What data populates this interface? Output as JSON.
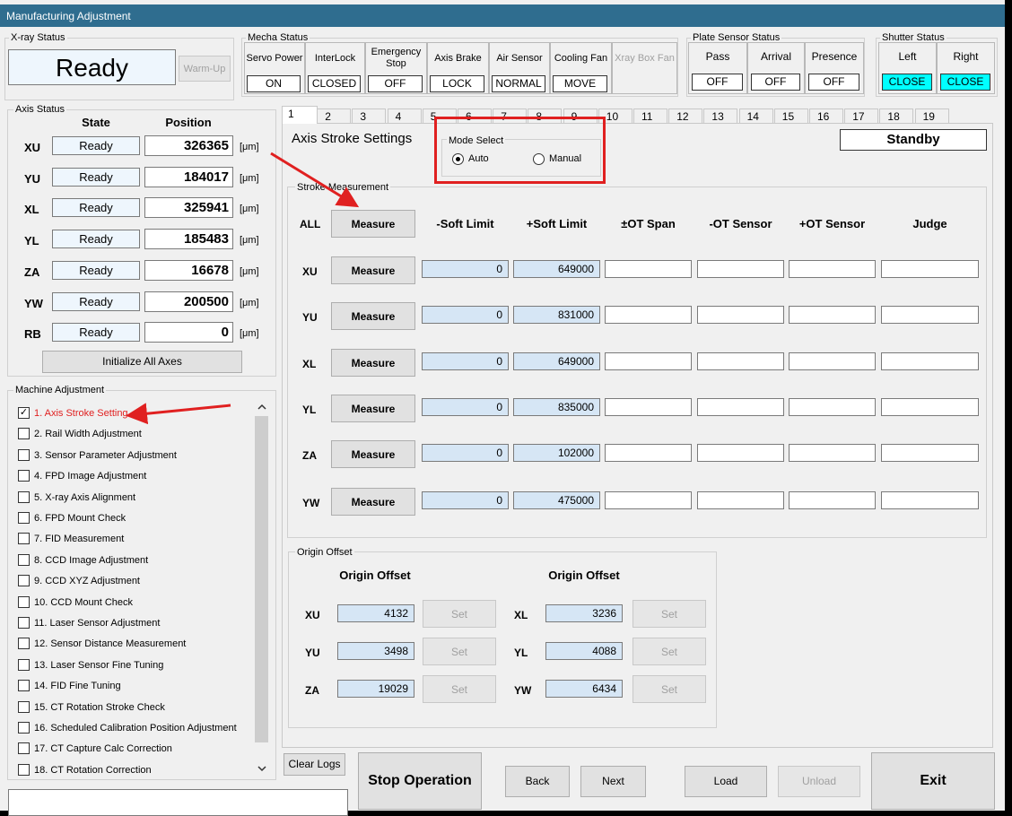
{
  "window": {
    "title": "Manufacturing Adjustment"
  },
  "xray": {
    "group_title": "X-ray Status",
    "status": "Ready",
    "warmup_label": "Warm-Up"
  },
  "mecha": {
    "group_title": "Mecha Status",
    "items": [
      {
        "label": "Servo Power",
        "value": "ON"
      },
      {
        "label": "InterLock",
        "value": "CLOSED"
      },
      {
        "label": "Emergency Stop",
        "value": "OFF"
      },
      {
        "label": "Axis Brake",
        "value": "LOCK"
      },
      {
        "label": "Air Sensor",
        "value": "NORMAL"
      },
      {
        "label": "Cooling Fan",
        "value": "MOVE"
      },
      {
        "label": "Xray Box Fan",
        "value": ""
      }
    ]
  },
  "plate": {
    "group_title": "Plate Sensor Status",
    "items": [
      {
        "label": "Pass",
        "value": "OFF"
      },
      {
        "label": "Arrival",
        "value": "OFF"
      },
      {
        "label": "Presence",
        "value": "OFF"
      }
    ]
  },
  "shutter": {
    "group_title": "Shutter Status",
    "items": [
      {
        "label": "Left",
        "value": "CLOSE"
      },
      {
        "label": "Right",
        "value": "CLOSE"
      }
    ]
  },
  "axis_status": {
    "group_title": "Axis Status",
    "col_state": "State",
    "col_position": "Position",
    "unit": "[μm]",
    "axes": [
      {
        "name": "XU",
        "state": "Ready",
        "position": "326365"
      },
      {
        "name": "YU",
        "state": "Ready",
        "position": "184017"
      },
      {
        "name": "XL",
        "state": "Ready",
        "position": "325941"
      },
      {
        "name": "YL",
        "state": "Ready",
        "position": "185483"
      },
      {
        "name": "ZA",
        "state": "Ready",
        "position": "16678"
      },
      {
        "name": "YW",
        "state": "Ready",
        "position": "200500"
      },
      {
        "name": "RB",
        "state": "Ready",
        "position": "0"
      }
    ],
    "init_button": "Initialize All Axes"
  },
  "machine_adjustment": {
    "group_title": "Machine Adjustment",
    "items": [
      {
        "label": "1. Axis Stroke Setting",
        "checked": true
      },
      {
        "label": "2. Rail Width Adjustment",
        "checked": false
      },
      {
        "label": "3. Sensor Parameter Adjustment",
        "checked": false
      },
      {
        "label": "4. FPD Image Adjustment",
        "checked": false
      },
      {
        "label": "5. X-ray Axis Alignment",
        "checked": false
      },
      {
        "label": "6. FPD Mount Check",
        "checked": false
      },
      {
        "label": "7. FID Measurement",
        "checked": false
      },
      {
        "label": "8. CCD Image Adjustment",
        "checked": false
      },
      {
        "label": "9. CCD XYZ Adjustment",
        "checked": false
      },
      {
        "label": "10. CCD Mount Check",
        "checked": false
      },
      {
        "label": "11. Laser Sensor Adjustment",
        "checked": false
      },
      {
        "label": "12. Sensor Distance Measurement",
        "checked": false
      },
      {
        "label": "13. Laser Sensor Fine Tuning",
        "checked": false
      },
      {
        "label": "14. FID Fine Tuning",
        "checked": false
      },
      {
        "label": "15. CT Rotation Stroke Check",
        "checked": false
      },
      {
        "label": "16. Scheduled Calibration Position Adjustment",
        "checked": false
      },
      {
        "label": "17. CT Capture Calc Correction",
        "checked": false
      },
      {
        "label": "18. CT Rotation Correction",
        "checked": false
      }
    ],
    "scroll_up": "^",
    "scroll_down": "v"
  },
  "tabs": [
    "1",
    "2",
    "3",
    "4",
    "5",
    "6",
    "7",
    "8",
    "9",
    "10",
    "11",
    "12",
    "13",
    "14",
    "15",
    "16",
    "17",
    "18",
    "19"
  ],
  "panel": {
    "title": "Axis Stroke Settings",
    "status": "Standby",
    "mode": {
      "title": "Mode Select",
      "auto": "Auto",
      "manual": "Manual",
      "selected": "Auto"
    }
  },
  "stroke": {
    "group_title": "Stroke Measurement",
    "all_label": "ALL",
    "measure_label": "Measure",
    "headers": [
      "-Soft Limit",
      "+Soft Limit",
      "±OT Span",
      "-OT Sensor",
      "+OT Sensor",
      "Judge"
    ],
    "rows": [
      {
        "axis": "XU",
        "minus": "0",
        "plus": "649000"
      },
      {
        "axis": "YU",
        "minus": "0",
        "plus": "831000"
      },
      {
        "axis": "XL",
        "minus": "0",
        "plus": "649000"
      },
      {
        "axis": "YL",
        "minus": "0",
        "plus": "835000"
      },
      {
        "axis": "ZA",
        "minus": "0",
        "plus": "102000"
      },
      {
        "axis": "YW",
        "minus": "0",
        "plus": "475000"
      }
    ]
  },
  "origin": {
    "group_title": "Origin Offset",
    "header": "Origin Offset",
    "set_label": "Set",
    "left": [
      {
        "axis": "XU",
        "value": "4132"
      },
      {
        "axis": "YU",
        "value": "3498"
      },
      {
        "axis": "ZA",
        "value": "19029"
      }
    ],
    "right": [
      {
        "axis": "XL",
        "value": "3236"
      },
      {
        "axis": "YL",
        "value": "4088"
      },
      {
        "axis": "YW",
        "value": "6434"
      }
    ]
  },
  "bottom": {
    "clear_logs": "Clear Logs",
    "stop": "Stop Operation",
    "back": "Back",
    "next": "Next",
    "load": "Load",
    "unload": "Unload",
    "exit": "Exit"
  },
  "colors": {
    "annotation": "#e02020",
    "title_bar": "#2f6d8f",
    "shutter_close": "#00ffff"
  }
}
